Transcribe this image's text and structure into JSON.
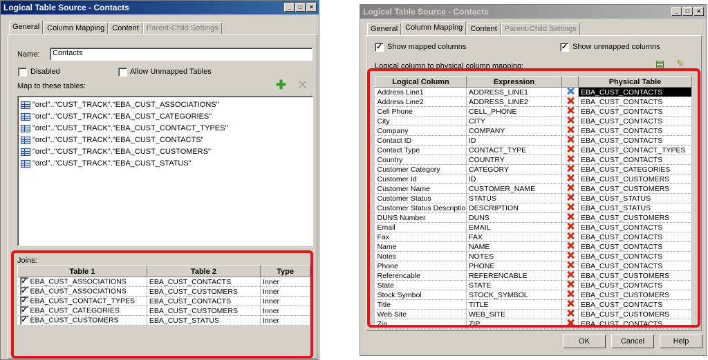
{
  "left": {
    "title": "Logical Table Source - Contacts",
    "tabs": [
      "General",
      "Column Mapping",
      "Content",
      "Parent-Child Settings"
    ],
    "name_label": "Name:",
    "name_value": "Contacts",
    "disabled_label": "Disabled",
    "allow_unmapped_label": "Allow Unmapped Tables",
    "map_label": "Map to these tables:",
    "tables": [
      "\"orcl\"..\"CUST_TRACK\".\"EBA_CUST_ASSOCIATIONS\"",
      "\"orcl\"..\"CUST_TRACK\".\"EBA_CUST_CATEGORIES\"",
      "\"orcl\"..\"CUST_TRACK\".\"EBA_CUST_CONTACT_TYPES\"",
      "\"orcl\"..\"CUST_TRACK\".\"EBA_CUST_CONTACTS\"",
      "\"orcl\"..\"CUST_TRACK\".\"EBA_CUST_CUSTOMERS\"",
      "\"orcl\"..\"CUST_TRACK\".\"EBA_CUST_STATUS\""
    ],
    "joins_label": "Joins:",
    "join_headers": [
      "Table 1",
      "Table 2",
      "Type"
    ],
    "joins": [
      [
        "EBA_CUST_ASSOCIATIONS",
        "EBA_CUST_CONTACTS",
        "Inner"
      ],
      [
        "EBA_CUST_ASSOCIATIONS",
        "EBA_CUST_CUSTOMERS",
        "Inner"
      ],
      [
        "EBA_CUST_CONTACT_TYPES",
        "EBA_CUST_CONTACTS",
        "Inner"
      ],
      [
        "EBA_CUST_CATEGORIES",
        "EBA_CUST_CUSTOMERS",
        "Inner"
      ],
      [
        "EBA_CUST_CUSTOMERS",
        "EBA_CUST_STATUS",
        "Inner"
      ]
    ]
  },
  "right": {
    "title": "Logical Table Source - Contacts",
    "tabs": [
      "General",
      "Column Mapping",
      "Content",
      "Parent-Child Settings"
    ],
    "show_mapped": "Show mapped columns",
    "show_unmapped": "Show unmapped columns",
    "mapping_label": "Logical column to physical column mapping:",
    "headers": [
      "Logical Column",
      "Expression",
      "Physical Table"
    ],
    "rows": [
      [
        "Address Line1",
        "ADDRESS_LINE1",
        "EBA_CUST_CONTACTS"
      ],
      [
        "Address Line2",
        "ADDRESS_LINE2",
        "EBA_CUST_CONTACTS"
      ],
      [
        "Cell Phone",
        "CELL_PHONE",
        "EBA_CUST_CONTACTS"
      ],
      [
        "City",
        "CITY",
        "EBA_CUST_CONTACTS"
      ],
      [
        "Company",
        "COMPANY",
        "EBA_CUST_CONTACTS"
      ],
      [
        "Contact ID",
        "ID",
        "EBA_CUST_CONTACTS"
      ],
      [
        "Contact Type",
        "CONTACT_TYPE",
        "EBA_CUST_CONTACT_TYPES"
      ],
      [
        "Country",
        "COUNTRY",
        "EBA_CUST_CONTACTS"
      ],
      [
        "Customer Category",
        "CATEGORY",
        "EBA_CUST_CATEGORIES"
      ],
      [
        "Customer Id",
        "ID",
        "EBA_CUST_CUSTOMERS"
      ],
      [
        "Customer Name",
        "CUSTOMER_NAME",
        "EBA_CUST_CUSTOMERS"
      ],
      [
        "Customer Status",
        "STATUS",
        "EBA_CUST_STATUS"
      ],
      [
        "Customer Status Description",
        "DESCRIPTION",
        "EBA_CUST_STATUS"
      ],
      [
        "DUNS Number",
        "DUNS",
        "EBA_CUST_CUSTOMERS"
      ],
      [
        "Email",
        "EMAIL",
        "EBA_CUST_CONTACTS"
      ],
      [
        "Fax",
        "FAX",
        "EBA_CUST_CONTACTS"
      ],
      [
        "Name",
        "NAME",
        "EBA_CUST_CONTACTS"
      ],
      [
        "Notes",
        "NOTES",
        "EBA_CUST_CONTACTS"
      ],
      [
        "Phone",
        "PHONE",
        "EBA_CUST_CONTACTS"
      ],
      [
        "Referencable",
        "REFERENCABLE",
        "EBA_CUST_CUSTOMERS"
      ],
      [
        "State",
        "STATE",
        "EBA_CUST_CONTACTS"
      ],
      [
        "Stock Symbol",
        "STOCK_SYMBOL",
        "EBA_CUST_CUSTOMERS"
      ],
      [
        "Title",
        "TITLE",
        "EBA_CUST_CONTACTS"
      ],
      [
        "Web Site",
        "WEB_SITE",
        "EBA_CUST_CUSTOMERS"
      ],
      [
        "Zip",
        "ZIP",
        "EBA_CUST_CONTACTS"
      ]
    ],
    "ok": "OK",
    "cancel": "Cancel",
    "help": "Help"
  }
}
